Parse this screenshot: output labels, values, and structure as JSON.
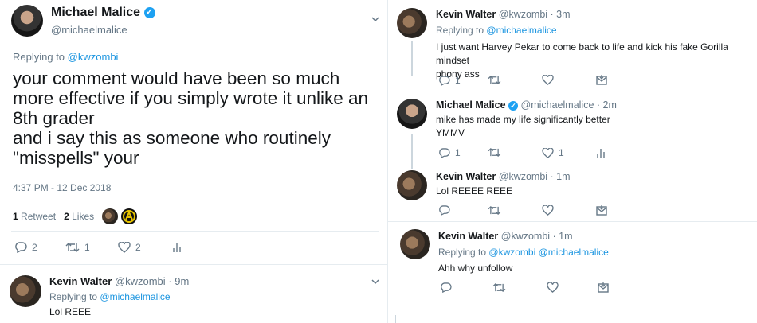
{
  "main_tweet": {
    "author_name": "Michael Malice",
    "author_handle": "@michaelmalice",
    "replying_to_label": "Replying to",
    "replying_to_handle": "@kwzombi",
    "text_lines": [
      "your comment would have been so much",
      "more effective if you simply wrote it unlike an",
      "8th grader",
      "and i say this as someone who routinely",
      "\"misspells\" your"
    ],
    "timestamp": "4:37 PM - 12 Dec 2018",
    "retweets_count": "1",
    "retweets_label": "Retweet",
    "likes_count": "2",
    "likes_label": "Likes",
    "actions": {
      "reply": "2",
      "retweet": "1",
      "like": "2"
    }
  },
  "left_reply": {
    "author_name": "Kevin Walter",
    "author_handle": "@kwzombi",
    "time": "· 9m",
    "replying_to_label": "Replying to",
    "replying_to_handle": "@michaelmalice",
    "text": "Lol REEE"
  },
  "right_thread": [
    {
      "author_name": "Kevin Walter",
      "author_handle": "@kwzombi",
      "time": "· 3m",
      "replying_to_label": "Replying to",
      "replying_to_handle": "@michaelmalice",
      "text_lines": [
        "I just want Harvey Pekar to come back to life and kick his fake Gorilla mindset",
        "phony ass"
      ],
      "actions": {
        "reply": "1",
        "retweet": "",
        "like": ""
      }
    },
    {
      "author_name": "Michael Malice",
      "author_handle": "@michaelmalice",
      "time": "· 2m",
      "text_lines": [
        "mike has made my life significantly better",
        "YMMV"
      ],
      "actions": {
        "reply": "1",
        "retweet": "",
        "like": "1"
      }
    },
    {
      "author_name": "Kevin Walter",
      "author_handle": "@kwzombi",
      "time": "· 1m",
      "text_lines": [
        "Lol REEEE REEE"
      ],
      "actions": {
        "reply": "",
        "retweet": "",
        "like": ""
      }
    },
    {
      "author_name": "Kevin Walter",
      "author_handle": "@kwzombi",
      "time": "· 1m",
      "replying_to_label": "Replying to",
      "replying_to_handle": "@kwzombi @michaelmalice",
      "text_lines": [
        "Ahh why unfollow"
      ],
      "actions": {
        "reply": "",
        "retweet": "",
        "like": ""
      }
    }
  ],
  "icons": {
    "reply": "reply-icon",
    "retweet": "retweet-icon",
    "like": "heart-icon",
    "dm": "envelope-icon",
    "analytics": "analytics-icon",
    "more": "chevron-down-icon",
    "verified": "verified-badge-icon"
  },
  "colors": {
    "link": "#1b95e0",
    "muted": "#657786",
    "verified": "#1da1f2"
  }
}
